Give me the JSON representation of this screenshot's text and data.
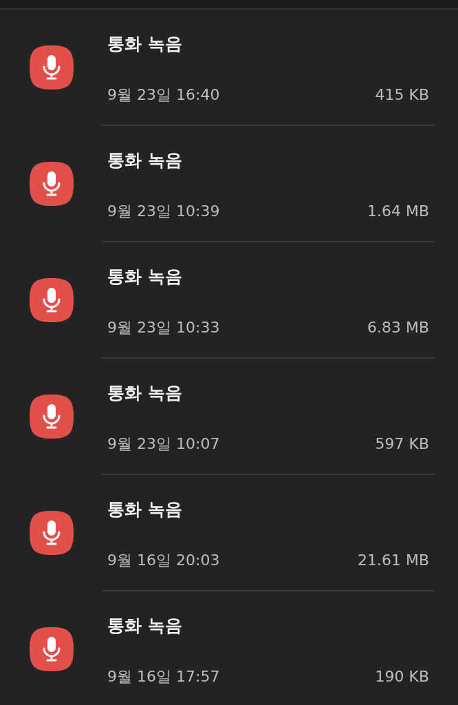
{
  "recordings": [
    {
      "title": "통화 녹음",
      "date": "9월 23일 16:40",
      "size": "415 KB"
    },
    {
      "title": "통화 녹음",
      "date": "9월 23일 10:39",
      "size": "1.64 MB"
    },
    {
      "title": "통화 녹음",
      "date": "9월 23일 10:33",
      "size": "6.83 MB"
    },
    {
      "title": "통화 녹음",
      "date": "9월 23일 10:07",
      "size": "597 KB"
    },
    {
      "title": "통화 녹음",
      "date": "9월 16일 20:03",
      "size": "21.61 MB"
    },
    {
      "title": "통화 녹음",
      "date": "9월 16일 17:57",
      "size": "190 KB"
    }
  ]
}
